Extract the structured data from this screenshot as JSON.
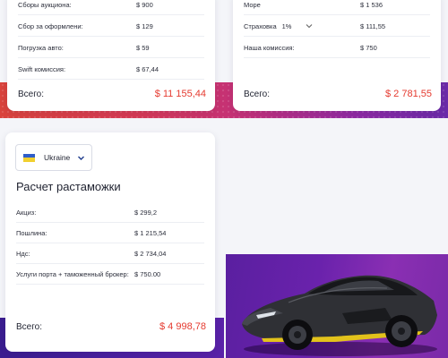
{
  "left_card": {
    "rows": [
      {
        "label": "Сборы аукциона:",
        "value": "$ 900"
      },
      {
        "label": "Сбор за оформлени:",
        "value": "$ 129"
      },
      {
        "label": "Погрузка авто:",
        "value": "$ 59"
      },
      {
        "label": "Swift комиссия:",
        "value": "$ 67,44"
      }
    ],
    "total_label": "Всего:",
    "total_value": "$ 11 155,44"
  },
  "right_card": {
    "rows": [
      {
        "label": "Море",
        "value": "$ 1 536"
      },
      {
        "label": "Страховка",
        "select_value": "1%",
        "value": "$ 111,55"
      },
      {
        "label": "Наша комиссия:",
        "value": "$ 750"
      }
    ],
    "total_label": "Всего:",
    "total_value": "$ 2 781,55"
  },
  "customs_card": {
    "country": {
      "flag": "ukraine-flag",
      "name": "Ukraine"
    },
    "title": "Расчет растаможки",
    "rows": [
      {
        "label": "Акциз:",
        "value": "$ 299,2"
      },
      {
        "label": "Пошлина:",
        "value": "$ 1 215,54"
      },
      {
        "label": "Ндс:",
        "value": "$ 2 734,04"
      },
      {
        "label": "Услуги порта + таможенный брокер:",
        "value": "$ 750.00"
      }
    ],
    "total_label": "Всего:",
    "total_value": "$ 4 998,78"
  },
  "colors": {
    "accent_red": "#e53a2f",
    "band_gradient_start": "#d9433c",
    "band_gradient_end": "#6a2aa8",
    "hero_purple": "#6a22ac"
  },
  "icons": [
    "chevron-down-icon",
    "ukraine-flag",
    "car-image"
  ]
}
